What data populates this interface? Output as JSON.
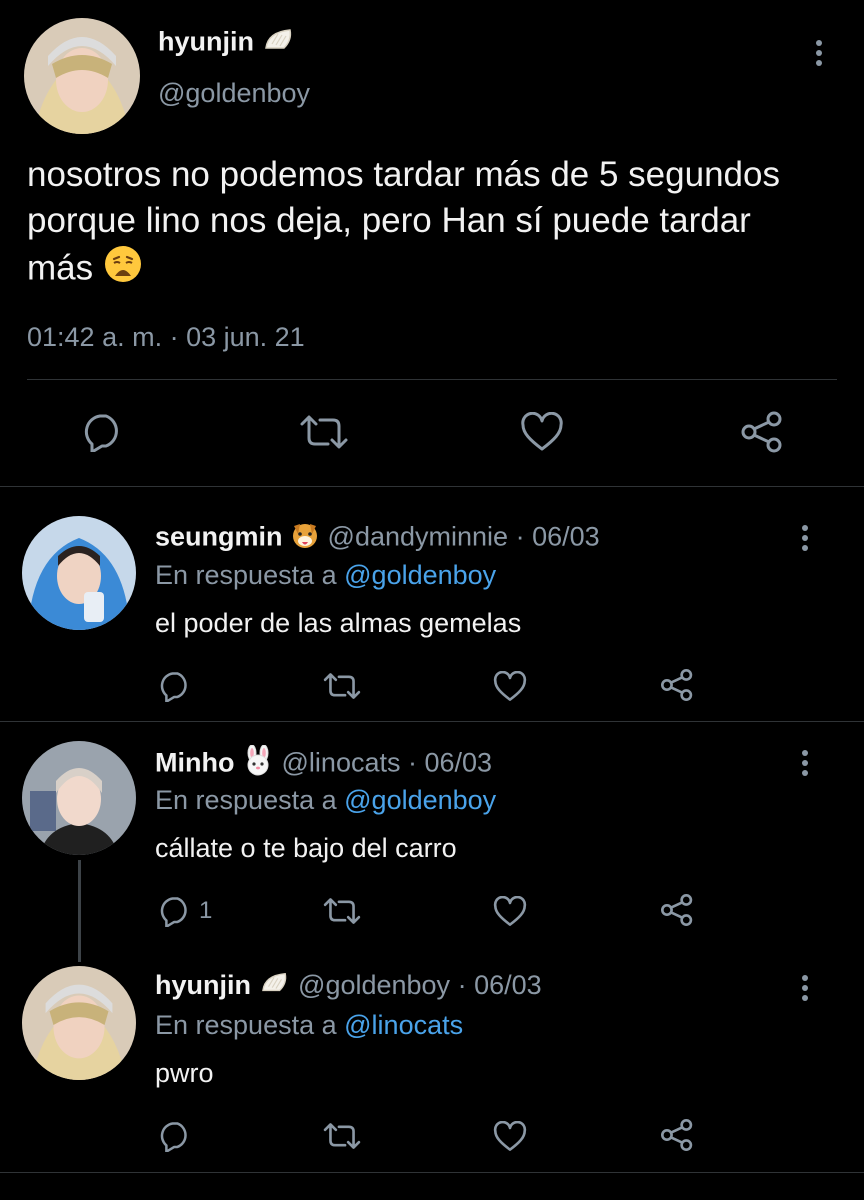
{
  "main_tweet": {
    "display_name": "hyunjin",
    "handle": "@goldenboy",
    "text": "nosotros no podemos tardar más de 5 segundos porque lino nos deja, pero Han sí puede tardar más",
    "timestamp": "01:42 a. m. · 03 jun. 21"
  },
  "replies": [
    {
      "display_name": "seungmin",
      "handle": "@dandyminnie",
      "date": "· 06/03",
      "reply_prefix": "En respuesta a",
      "reply_to": "@goldenboy",
      "text": "el poder de las almas gemelas",
      "reply_count": ""
    },
    {
      "display_name": "Minho",
      "handle": "@linocats",
      "date": "· 06/03",
      "reply_prefix": "En respuesta a",
      "reply_to": "@goldenboy",
      "text": "cállate o te bajo del carro",
      "reply_count": "1"
    },
    {
      "display_name": "hyunjin",
      "handle": "@goldenboy",
      "date": "· 06/03",
      "reply_prefix": "En respuesta a",
      "reply_to": "@linocats",
      "text": "pwro",
      "reply_count": ""
    }
  ],
  "colors": {
    "background": "#000000",
    "text": "#e7e9ea",
    "muted": "#8b98a5",
    "link": "#4aa3ea",
    "divider": "#2f3336"
  }
}
